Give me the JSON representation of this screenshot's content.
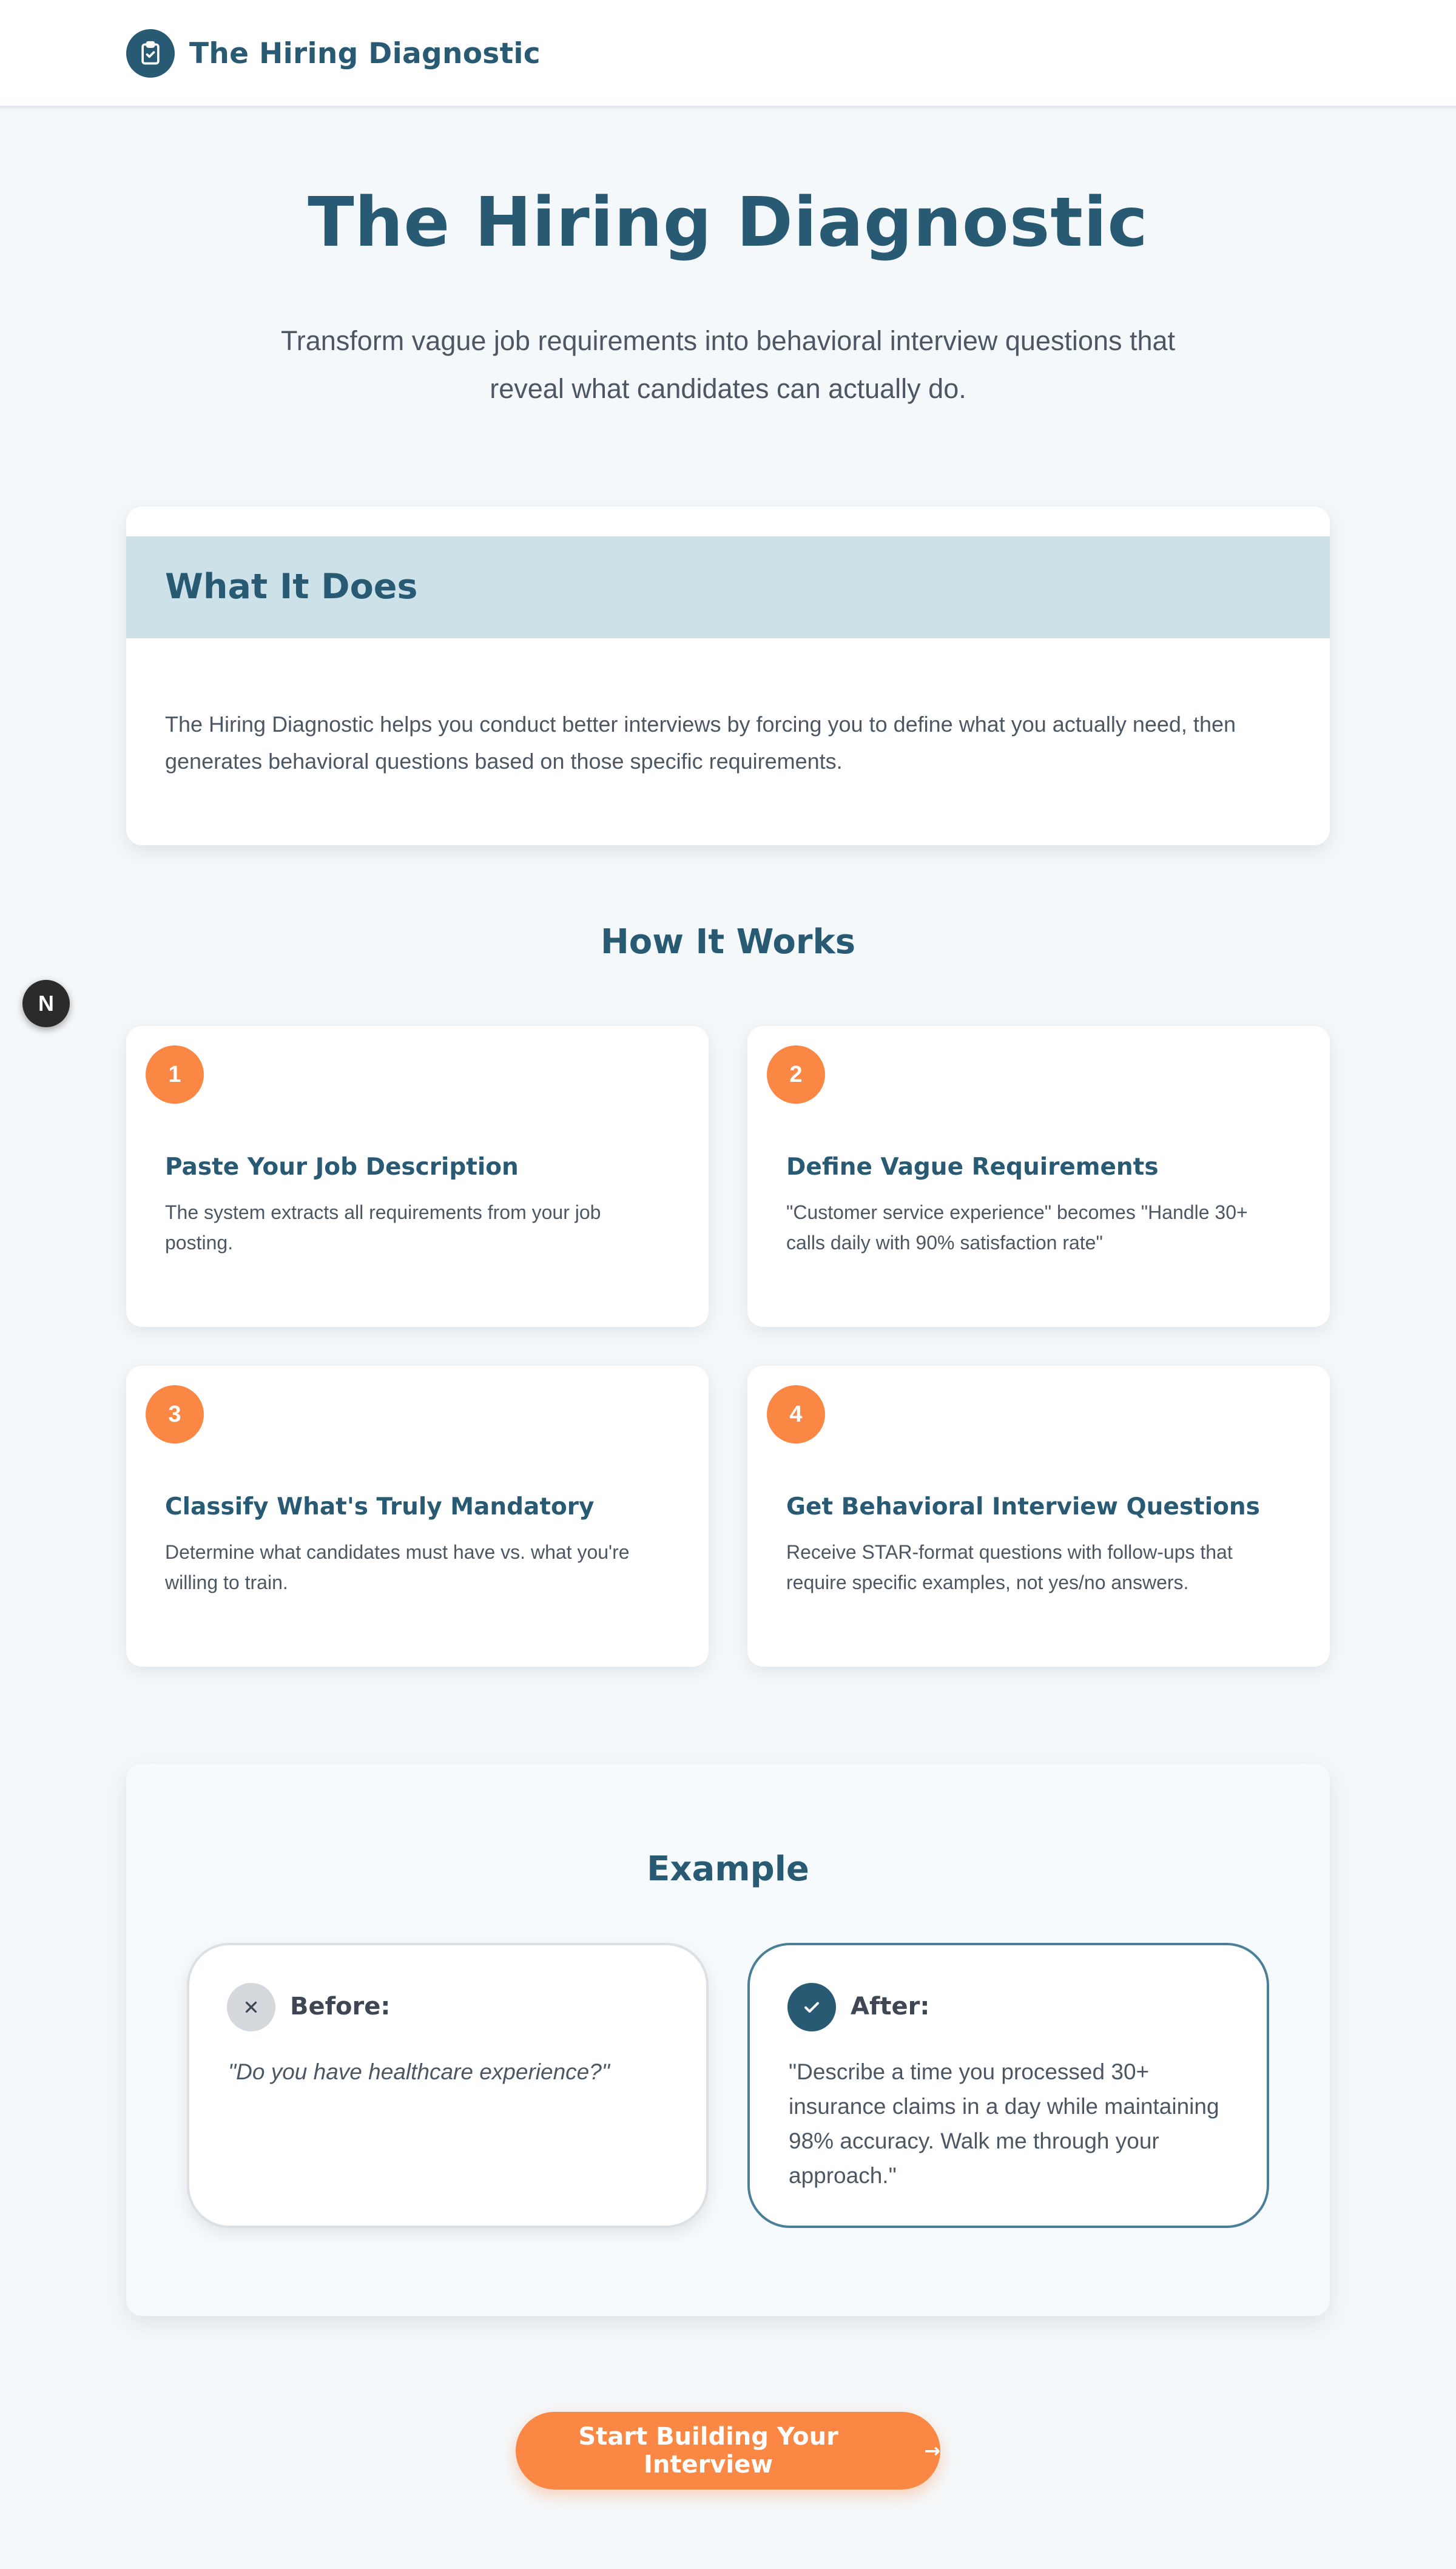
{
  "header": {
    "app_name": "The Hiring Diagnostic",
    "logo_icon": "clipboard-check-icon"
  },
  "hero": {
    "title": "The Hiring Diagnostic",
    "subtitle": "Transform vague job requirements into behavioral interview questions that reveal what candidates can actually do."
  },
  "what_it_does": {
    "title": "What It Does",
    "body": "The Hiring Diagnostic helps you conduct better interviews by forcing you to define what you actually need, then generates behavioral questions based on those specific requirements."
  },
  "how_it_works": {
    "title": "How It Works",
    "steps": [
      {
        "number": "1",
        "title": "Paste Your Job Description",
        "description": "The system extracts all requirements from your job posting."
      },
      {
        "number": "2",
        "title": "Define Vague Requirements",
        "description": "\"Customer service experience\" becomes \"Handle 30+ calls daily with 90% satisfaction rate\""
      },
      {
        "number": "3",
        "title": "Classify What's Truly Mandatory",
        "description": "Determine what candidates must have vs. what you're willing to train."
      },
      {
        "number": "4",
        "title": "Get Behavioral Interview Questions",
        "description": "Receive STAR-format questions with follow-ups that require specific examples, not yes/no answers."
      }
    ]
  },
  "example": {
    "title": "Example",
    "before": {
      "label": "Before:",
      "icon": "x-icon",
      "text": "\"Do you have healthcare experience?\""
    },
    "after": {
      "label": "After:",
      "icon": "check-icon",
      "text": "\"Describe a time you processed 30+ insurance claims in a day while maintaining 98% accuracy. Walk me through your approach.\""
    }
  },
  "cta": {
    "label": "Start Building Your Interview",
    "arrow": "→"
  },
  "floating_badge": {
    "letter": "N"
  },
  "colors": {
    "primary": "#285a74",
    "accent": "#fb8744",
    "header_band": "#cce1e8",
    "background": "#f5f8fa"
  }
}
